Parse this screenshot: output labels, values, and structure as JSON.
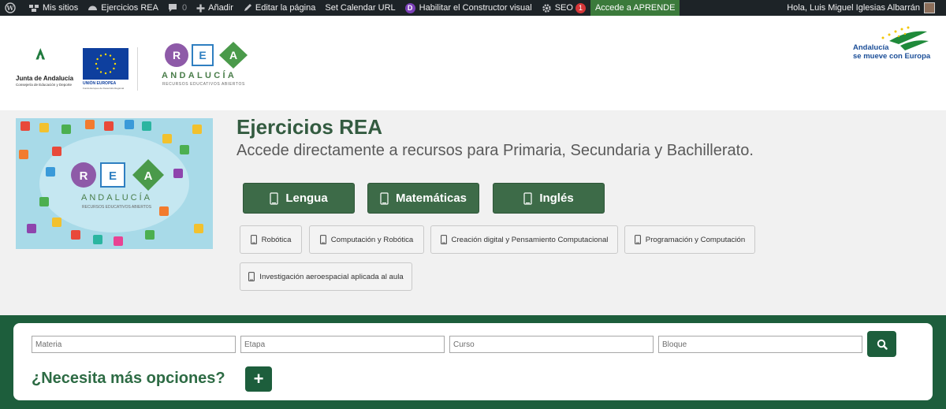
{
  "adminbar": {
    "my_sites": "Mis sitios",
    "site_name": "Ejercicios REA",
    "comments_count": "0",
    "add_new": "Añadir",
    "edit_page": "Editar la página",
    "set_calendar": "Set Calendar URL",
    "visual_builder": "Habilitar el Constructor visual",
    "seo": "SEO",
    "seo_badge": "1",
    "aprende": "Accede a APRENDE",
    "greeting": "Hola, Luis Miguel Iglesias Albarrán"
  },
  "header": {
    "junta_title": "Junta de Andalucía",
    "junta_sub": "Consejería de Educación y Deporte",
    "eu_title": "UNIÓN EUROPEA",
    "eu_sub": "Fondo Europeo de Desarrollo Regional",
    "rea_letters": [
      "R",
      "E",
      "A"
    ],
    "rea_andalucia": "ANDALUCÍA",
    "rea_sub": "RECURSOS EDUCATIVOS ABIERTOS",
    "andalucia_line1": "Andalucía",
    "andalucia_line2": "se mueve con Europa"
  },
  "hero": {
    "image_rea_letters": [
      "R",
      "E",
      "A"
    ],
    "image_andalucia": "ANDALUCÍA",
    "image_sub": "RECURSOS EDUCATIVOS ABIERTOS",
    "title": "Ejercicios REA",
    "subtitle": "Accede directamente a recursos para Primaria, Secundaria y Bachillerato.",
    "main_buttons": [
      "Lengua",
      "Matemáticas",
      "Inglés"
    ],
    "secondary_buttons": [
      "Robótica",
      "Computación y Robótica",
      "Creación digital y Pensamiento Computacional",
      "Programación y Computación",
      "Investigación aeroespacial aplicada al aula"
    ]
  },
  "search": {
    "placeholders": [
      "Materia",
      "Etapa",
      "Curso",
      "Bloque"
    ],
    "more_options": "¿Necesita más opciones?",
    "plus_label": "+"
  },
  "colors": {
    "brand_green": "#3d6b48",
    "band_green": "#1d5e3c",
    "admin_bar": "#1d2327"
  }
}
